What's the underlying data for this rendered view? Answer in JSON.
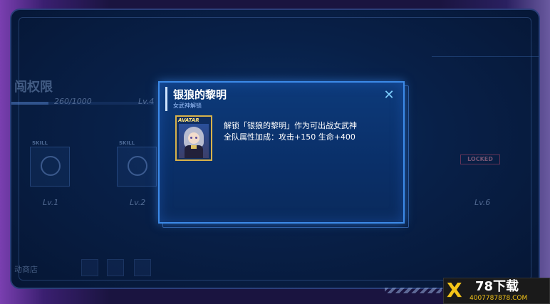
{
  "background": {
    "title": "闯权限",
    "progress_text": "260/1000",
    "progress_fraction": 0.26,
    "next_level": "Lv.4",
    "skills": [
      {
        "tag": "SKILL",
        "level": "Lv.1"
      },
      {
        "tag": "SKILL",
        "level": "Lv.2"
      }
    ],
    "locked_label": "LOCKED",
    "locked_level": "Lv.6",
    "bottom_label": "动商店"
  },
  "dialog": {
    "title": "银狼的黎明",
    "subtitle": "女武神解锁",
    "close_symbol": "✕",
    "avatar_tag": "AVATAR",
    "line1": "解锁「银狼的黎明」作为可出战女武神",
    "line2": "全队属性加成：攻击+150  生命+400"
  },
  "watermark": {
    "x_glyph": "X",
    "brand": "78下载",
    "url": "4007787878.COM"
  },
  "colors": {
    "accent_blue": "#3c8ae8",
    "avatar_border": "#d8b24a",
    "locked_red": "#c04a6a"
  }
}
